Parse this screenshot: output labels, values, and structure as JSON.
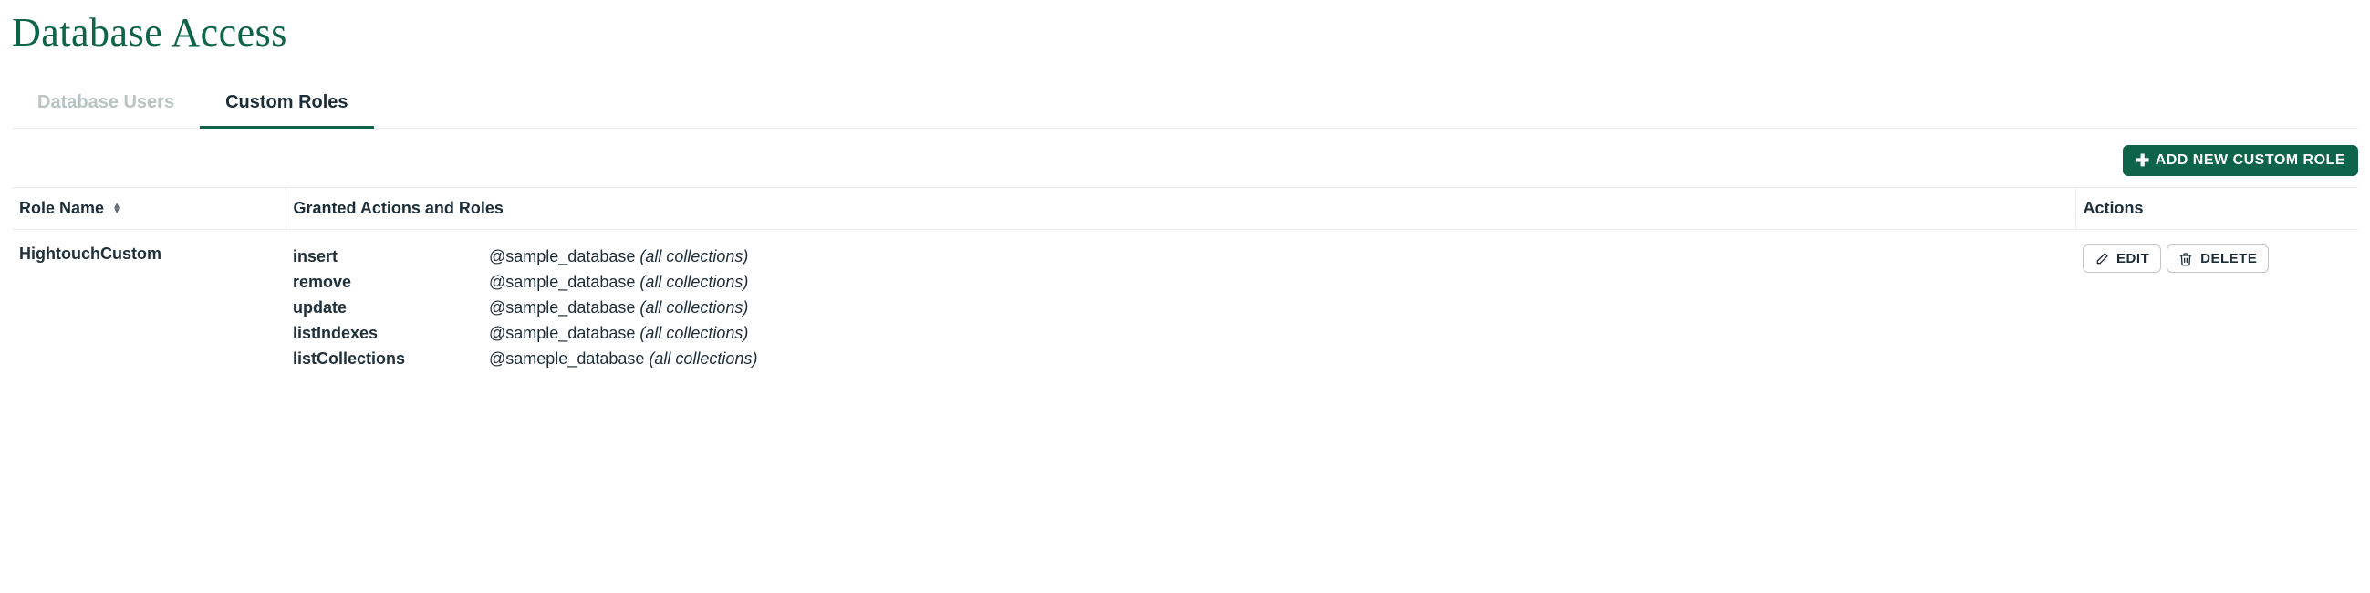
{
  "page": {
    "title": "Database Access"
  },
  "tabs": {
    "items": [
      {
        "label": "Database Users",
        "active": false
      },
      {
        "label": "Custom Roles",
        "active": true
      }
    ]
  },
  "toolbar": {
    "add_label": "ADD NEW CUSTOM ROLE"
  },
  "table": {
    "headers": {
      "role_name": "Role Name",
      "granted": "Granted Actions and Roles",
      "actions": "Actions"
    },
    "rows": [
      {
        "role_name": "HightouchCustom",
        "granted": [
          {
            "action": "insert",
            "target": "@sample_database",
            "scope": "(all collections)"
          },
          {
            "action": "remove",
            "target": "@sample_database",
            "scope": "(all collections)"
          },
          {
            "action": "update",
            "target": "@sample_database",
            "scope": "(all collections)"
          },
          {
            "action": "listIndexes",
            "target": "@sample_database",
            "scope": "(all collections)"
          },
          {
            "action": "listCollections",
            "target": "@sameple_database",
            "scope": "(all collections)"
          }
        ]
      }
    ]
  },
  "row_actions": {
    "edit": "EDIT",
    "delete": "DELETE"
  }
}
